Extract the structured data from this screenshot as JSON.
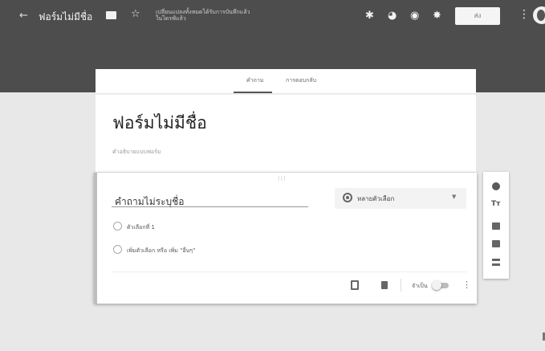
{
  "topbar": {
    "back_glyph": "←",
    "title": "ฟอร์มไม่มีชื่อ",
    "folder_icon": "folder-icon",
    "star_glyph": "☆",
    "save_status_line1": "เปลี่ยนแปลงทั้งหมดได้รับการบันทึกแล้ว",
    "save_status_line2": "ในไดรฟ์แล้ว",
    "icons": [
      "customize-theme-icon",
      "palette-icon",
      "preview-eye-icon",
      "settings-gear-icon"
    ],
    "icon_glyphs": [
      "✱",
      "◕",
      "◉",
      "✸"
    ],
    "send_label": "ส่ง",
    "more_glyph": "⋮",
    "colors": {
      "bar": "#4d4d4d",
      "page": "#e8e8e8"
    }
  },
  "tabs": {
    "active": "คำถาม",
    "second": "การตอบกลับ"
  },
  "form": {
    "title": "ฟอร์มไม่มีชื่อ",
    "description": "คำอธิบายแบบฟอร์ม"
  },
  "question": {
    "drag_glyph": "⁝⁝⁝",
    "title": "คำถามไม่ระบุชื่อ",
    "type_label": "หลายตัวเลือก",
    "type_caret": "▼",
    "option1": "ตัวเลือกที่ 1",
    "option2": "เพิ่มตัวเลือก หรือ เพิ่ม \"อื่นๆ\"",
    "required_label": "จำเป็น",
    "more_glyph": "⋮"
  },
  "side_toolbar": {
    "text_glyph": "Tт",
    "icons": [
      "add-question-icon",
      "add-title-icon",
      "add-image-icon",
      "add-video-icon",
      "add-section-icon"
    ]
  }
}
